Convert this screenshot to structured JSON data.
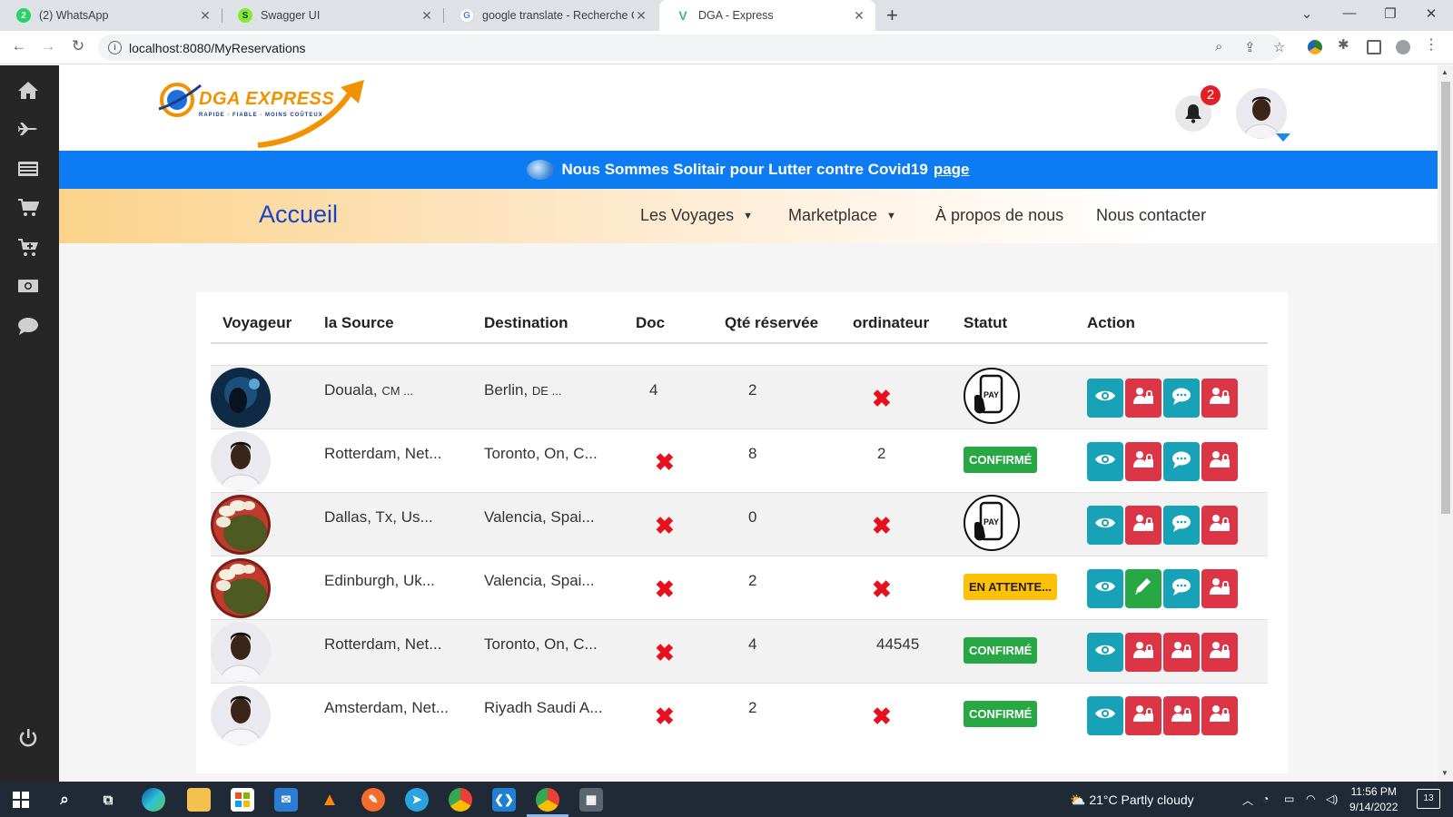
{
  "browser": {
    "tabs": [
      {
        "title": "(2) WhatsApp",
        "icon": "whatsapp-icon",
        "color": "#25d366",
        "favtext": "2"
      },
      {
        "title": "Swagger UI",
        "icon": "swagger-icon",
        "color": "#85ea2d",
        "favtext": "S"
      },
      {
        "title": "google translate - Recherche Goo",
        "icon": "google-icon",
        "color": "#4285f4",
        "favtext": "G"
      },
      {
        "title": "DGA - Express",
        "icon": "vue-icon",
        "color": "#41b883",
        "favtext": "V"
      }
    ],
    "url": "localhost:8080/MyReservations"
  },
  "header": {
    "logo_name": "DGA EXPRESS",
    "logo_tagline": "RAPIDE · FIABLE · MOINS COÛTEUX",
    "notifications_count": "2"
  },
  "banner": {
    "text": "Nous Sommes Solitair pour Lutter contre Covid19",
    "link": "page"
  },
  "nav": {
    "home": "Accueil",
    "items": [
      "Les Voyages",
      "Marketplace",
      "À propos de nous",
      "Nous contacter"
    ]
  },
  "table": {
    "headers": [
      "Voyageur",
      "la Source",
      "Destination",
      "Doc",
      "Qté réservée",
      "ordinateur",
      "Statut",
      "Action"
    ],
    "rows": [
      {
        "source": "Douala,",
        "source_cc": "CM ...",
        "dest": "Berlin,",
        "dest_cc": "DE ...",
        "doc": "4",
        "qty": "2",
        "ordinateur": "",
        "status": "pay",
        "status_label": "",
        "actions": [
          "view",
          "lock",
          "chat",
          "lock"
        ]
      },
      {
        "source": "Rotterdam, Net...",
        "source_cc": "",
        "dest": "Toronto, On, C...",
        "dest_cc": "",
        "doc": "",
        "qty": "8",
        "ordinateur": "2",
        "status": "ok",
        "status_label": "CONFIRMÉ",
        "actions": [
          "view",
          "lock",
          "chat",
          "lock"
        ]
      },
      {
        "source": "Dallas, Tx, Us...",
        "source_cc": "",
        "dest": "Valencia, Spai...",
        "dest_cc": "",
        "doc": "",
        "qty": "0",
        "ordinateur": "",
        "status": "pay",
        "status_label": "",
        "actions": [
          "view",
          "lock",
          "chat",
          "lock"
        ]
      },
      {
        "source": "Edinburgh, Uk...",
        "source_cc": "",
        "dest": "Valencia, Spai...",
        "dest_cc": "",
        "doc": "",
        "qty": "2",
        "ordinateur": "",
        "status": "wait",
        "status_label": "EN ATTENTE...",
        "actions": [
          "view",
          "edit",
          "chat",
          "lock"
        ]
      },
      {
        "source": "Rotterdam, Net...",
        "source_cc": "",
        "dest": "Toronto, On, C...",
        "dest_cc": "",
        "doc": "",
        "qty": "4",
        "ordinateur": "44545",
        "status": "ok",
        "status_label": "CONFIRMÉ",
        "actions": [
          "view",
          "lock",
          "lock",
          "lock"
        ]
      },
      {
        "source": "Amsterdam, Net...",
        "source_cc": "",
        "dest": "Riyadh Saudi A...",
        "dest_cc": "",
        "doc": "",
        "qty": "2",
        "ordinateur": "",
        "status": "ok",
        "status_label": "CONFIRMÉ",
        "actions": [
          "view",
          "lock",
          "lock",
          "lock"
        ]
      }
    ]
  },
  "taskbar": {
    "weather": "21°C  Partly cloudy",
    "time": "11:56 PM",
    "date": "9/14/2022",
    "notif_count": "13"
  },
  "colors": {
    "sidebar": "#262626",
    "banner": "#0d7cf2",
    "accent_blue": "#1a44c8",
    "info": "#17a2b8",
    "danger": "#dc3545",
    "success": "#28a745",
    "warning": "#ffc107"
  }
}
